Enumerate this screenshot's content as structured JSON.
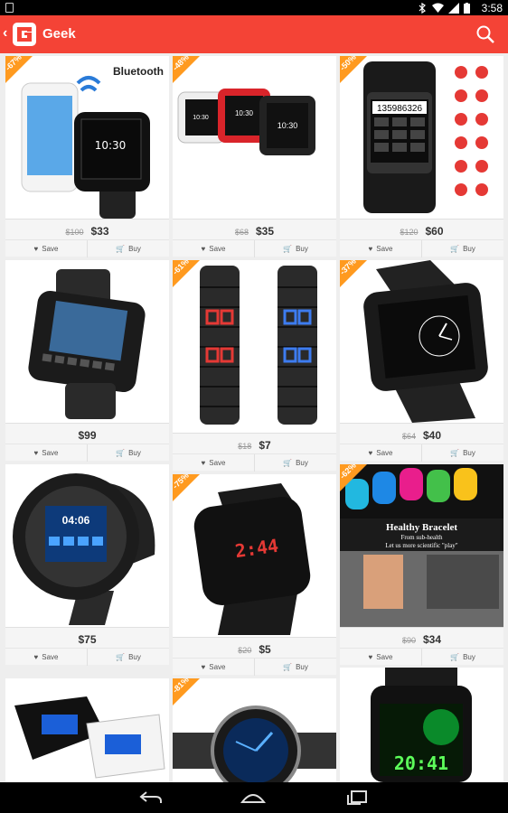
{
  "status": {
    "time": "3:58"
  },
  "appbar": {
    "title": "Geek"
  },
  "labels": {
    "save": "Save",
    "buy": "Buy"
  },
  "products": [
    {
      "badge": "-67%",
      "old_price": "$100",
      "price": "$33",
      "brand_text": "Bluetooth"
    },
    {
      "badge": "-48%",
      "old_price": "$68",
      "price": "$35"
    },
    {
      "badge": "-50%",
      "old_price": "$120",
      "price": "$60",
      "screen_text": "135986326"
    },
    {
      "badge": "",
      "old_price": "",
      "price": "$99"
    },
    {
      "badge": "-61%",
      "old_price": "$18",
      "price": "$7"
    },
    {
      "badge": "-37%",
      "old_price": "$64",
      "price": "$40"
    },
    {
      "badge": "",
      "old_price": "",
      "price": "$75",
      "screen_text": "04:06"
    },
    {
      "badge": "-75%",
      "old_price": "$20",
      "price": "$5",
      "screen_text": "2:44"
    },
    {
      "badge": "-62%",
      "old_price": "$90",
      "price": "$34",
      "banner_title": "Healthy Bracelet",
      "banner_sub1": "From sub-health",
      "banner_sub2": "Let us more scientific \"play\""
    },
    {
      "badge": ""
    },
    {
      "badge": "-81%"
    },
    {
      "badge": "",
      "screen_text": "20:41"
    }
  ],
  "colors": {
    "accent": "#f44336",
    "badge": "#ff9a1f"
  }
}
